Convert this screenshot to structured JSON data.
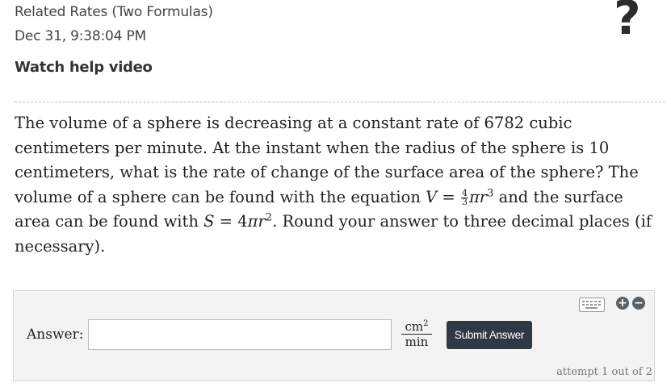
{
  "header": {
    "title": "Related Rates (Two Formulas)",
    "timestamp": "Dec 31, 9:38:04 PM",
    "help_link": "Watch help video",
    "help_icon": "?"
  },
  "question": {
    "line1": "The volume of a sphere is decreasing at a constant rate of 6782 cubic centimeters per minute. At the instant when the radius of the sphere is 10 centimeters, what is the rate of change of the surface area of the sphere? The volume of a sphere can be found with the equation ",
    "eq1_lhs": "V",
    "eq1_eq": " = ",
    "eq1_num": "4",
    "eq1_den": "3",
    "eq1_rest": "πr",
    "eq1_exp": "3",
    "mid": " and the surface area can be found with ",
    "eq2_lhs": "S",
    "eq2_eq": " = ",
    "eq2_coef": "4",
    "eq2_rest": "πr",
    "eq2_exp": "2",
    "end": ". Round your answer to three decimal places (if necessary)."
  },
  "answer_area": {
    "label": "Answer:",
    "input_value": "",
    "unit_num": "cm",
    "unit_exp": "2",
    "unit_den": "min",
    "submit_label": "Submit Answer",
    "attempt_text": "attempt 1 out of 2",
    "plus_icon": "+",
    "minus_icon": "−"
  }
}
